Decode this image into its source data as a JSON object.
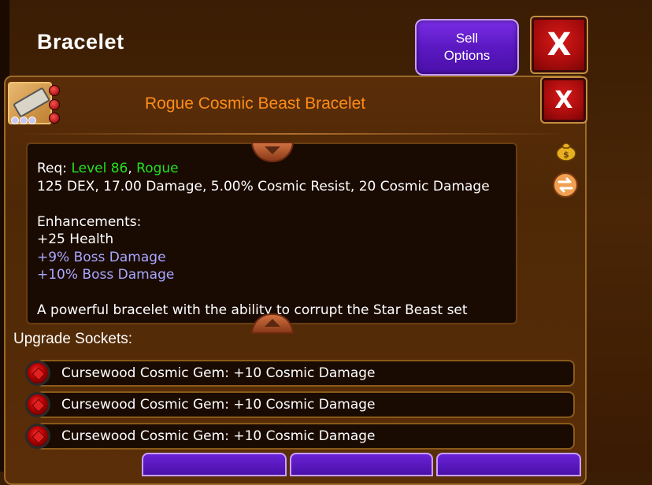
{
  "screen": {
    "title": "Bracelet"
  },
  "header": {
    "sell_options_label": "Sell\nOptions",
    "close_label": "X"
  },
  "item": {
    "name": "Rogue Cosmic Beast Bracelet",
    "close_label": "X",
    "name_color": "#ff8c1a"
  },
  "description": {
    "req_prefix": "Req: ",
    "req_level": "Level 86",
    "req_sep": ", ",
    "req_class": "Rogue",
    "stats": "125 DEX, 17.00 Damage, 5.00% Cosmic Resist, 20 Cosmic Damage",
    "enhancements_heading": "Enhancements:",
    "enhancements": [
      {
        "text": "+25 Health",
        "color": "#ffffff"
      },
      {
        "text": "+9% Boss Damage",
        "color": "#a8a8ff"
      },
      {
        "text": "+10% Boss Damage",
        "color": "#a8a8ff"
      }
    ],
    "flavor": "A powerful bracelet with the ability to corrupt the Star Beast set"
  },
  "sockets": {
    "label": "Upgrade Sockets:",
    "items": [
      {
        "text": "Cursewood Cosmic Gem: +10 Cosmic Damage"
      },
      {
        "text": "Cursewood Cosmic Gem: +10 Cosmic Damage"
      },
      {
        "text": "Cursewood Cosmic Gem: +10 Cosmic Damage"
      }
    ]
  },
  "icons": {
    "item_icon": "bracelet-icon",
    "gold": "gold-bag-icon",
    "swap": "swap-icon",
    "socket_gem": "red-gem-icon"
  }
}
